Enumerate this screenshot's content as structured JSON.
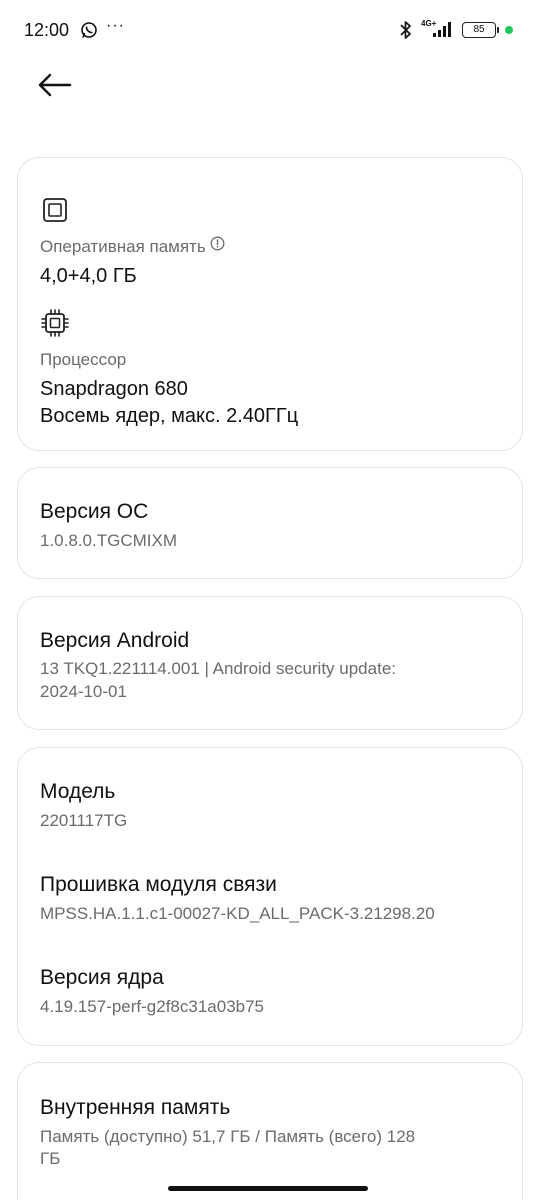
{
  "status_bar": {
    "time": "12:00",
    "more": "···",
    "network": "4G+",
    "battery": "85",
    "icons": [
      "whatsapp-icon",
      "bluetooth-icon",
      "signal-icon",
      "battery-icon"
    ]
  },
  "hardware": {
    "ram_label": "Оперативная память",
    "ram_value": "4,0+4,0 ГБ",
    "cpu_label": "Процессор",
    "cpu_line1": "Snapdragon 680",
    "cpu_line2": "Восемь ядер, макс. 2.40ГГц"
  },
  "os": {
    "title": "Версия ОС",
    "value": "1.0.8.0.TGCMIXM"
  },
  "android": {
    "title": "Версия Android",
    "line1": "13 TKQ1.221114.001 | Android security update:",
    "line2": "2024-10-01"
  },
  "device": {
    "model_title": "Модель",
    "model_value": "2201117TG",
    "baseband_title": "Прошивка модуля связи",
    "baseband_value": "MPSS.HA.1.1.c1-00027-KD_ALL_PACK-3.21298.20",
    "kernel_title": "Версия ядра",
    "kernel_value": "4.19.157-perf-g2f8c31a03b75"
  },
  "storage": {
    "title": "Внутренняя память",
    "line1": "Память (доступно)  51,7 ГБ / Память (всего)  128",
    "line2": "ГБ"
  },
  "colors": {
    "accent_dot": "#22c55e",
    "card_border": "#e3e3e3",
    "secondary_text": "#6b6b6b"
  }
}
